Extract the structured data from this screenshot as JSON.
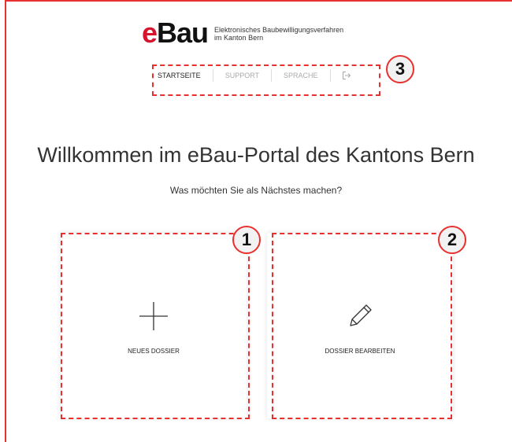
{
  "header": {
    "logo_e": "e",
    "logo_bau": "Bau",
    "subtitle_line1": "Elektronisches Baubewilligungsverfahren",
    "subtitle_line2": "im Kanton Bern"
  },
  "nav": {
    "items": [
      {
        "label": "STARTSEITE",
        "active": true
      },
      {
        "label": "SUPPORT",
        "active": false
      },
      {
        "label": "SPRACHE",
        "active": false
      }
    ],
    "logout_icon": "logout-icon"
  },
  "main": {
    "title": "Willkommen im eBau-Portal des Kantons Bern",
    "question": "Was möchten Sie als Nächstes machen?",
    "cards": [
      {
        "label": "NEUES DOSSIER",
        "icon": "plus-icon"
      },
      {
        "label": "DOSSIER BEARBEITEN",
        "icon": "pencil-icon"
      }
    ]
  },
  "annotations": {
    "badge_1": "1",
    "badge_2": "2",
    "badge_3": "3"
  },
  "colors": {
    "brand_red": "#d6142d",
    "annotation_red": "#e8312f",
    "text": "#333333",
    "nav_inactive": "#aaaaaa"
  }
}
